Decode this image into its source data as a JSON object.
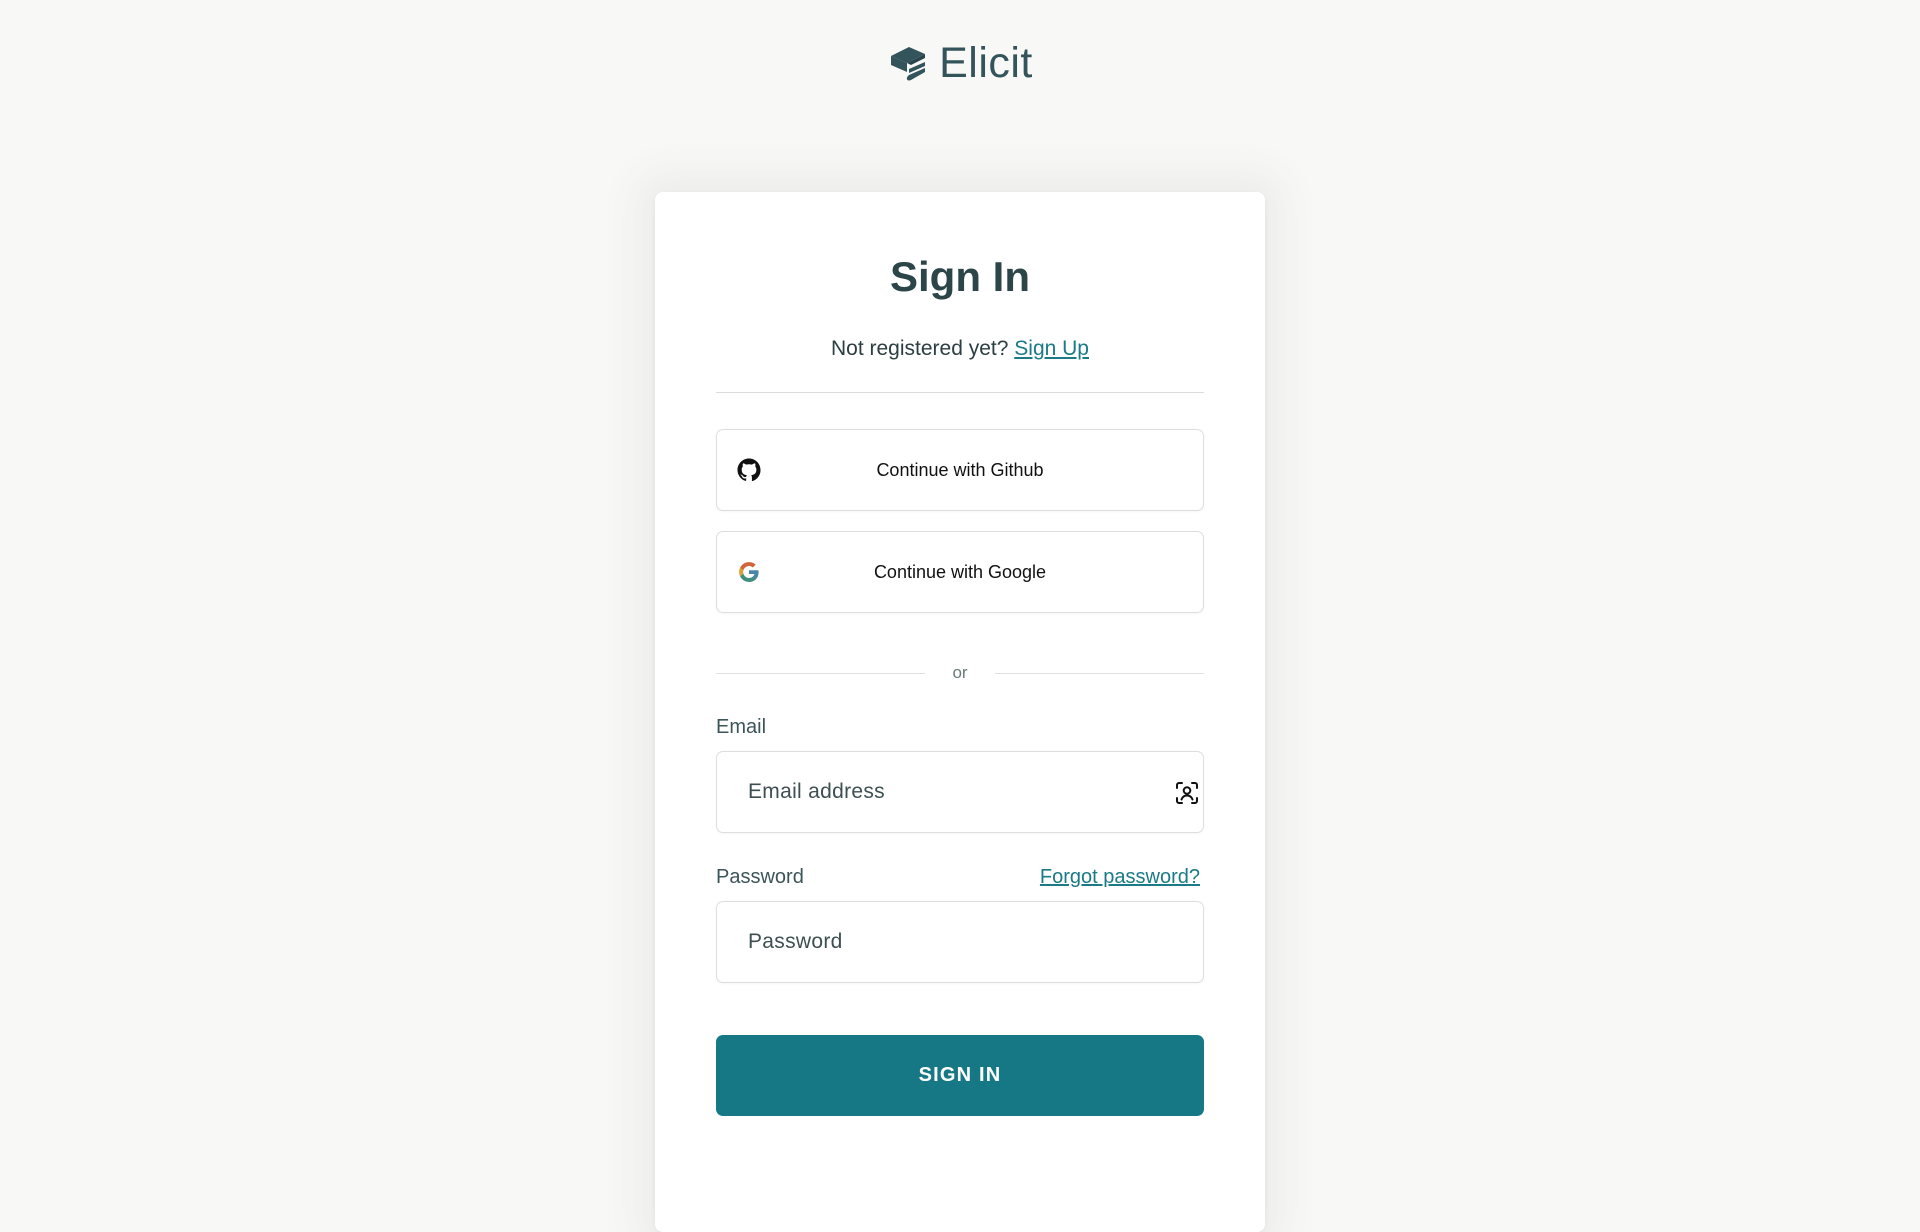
{
  "brand": {
    "name": "Elicit"
  },
  "signin": {
    "title": "Sign In",
    "not_registered": "Not registered yet?",
    "signup_link": "Sign Up",
    "github_label": "Continue with Github",
    "google_label": "Continue with Google",
    "or_text": "or",
    "email_label": "Email",
    "email_placeholder": "Email address",
    "email_value": "",
    "password_label": "Password",
    "forgot_link": "Forgot password?",
    "password_placeholder": "Password",
    "password_value": "",
    "submit_label": "SIGN IN"
  },
  "colors": {
    "accent": "#167884",
    "link": "#1a7a85",
    "heading": "#2b4549",
    "background": "#f8f8f7"
  },
  "icons": [
    "elicit-logo-icon",
    "github-icon",
    "google-icon",
    "contact-card-icon"
  ]
}
